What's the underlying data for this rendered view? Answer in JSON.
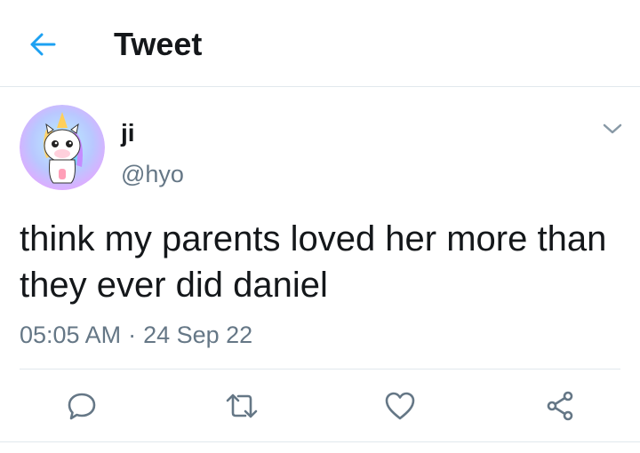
{
  "header": {
    "title": "Tweet",
    "back_icon": "arrow-left-icon"
  },
  "tweet": {
    "author_name": "ji",
    "author_handle": "@hyo",
    "text": "think my parents loved her more than they ever did daniel",
    "time": "05:05 AM",
    "separator": "·",
    "date": "24 Sep 22"
  },
  "actions": [
    "reply-icon",
    "retweet-icon",
    "like-icon",
    "share-icon"
  ],
  "colors": {
    "accent": "#1da1f2",
    "text": "#14171a",
    "secondary": "#657786",
    "border": "#e1e8ed"
  }
}
